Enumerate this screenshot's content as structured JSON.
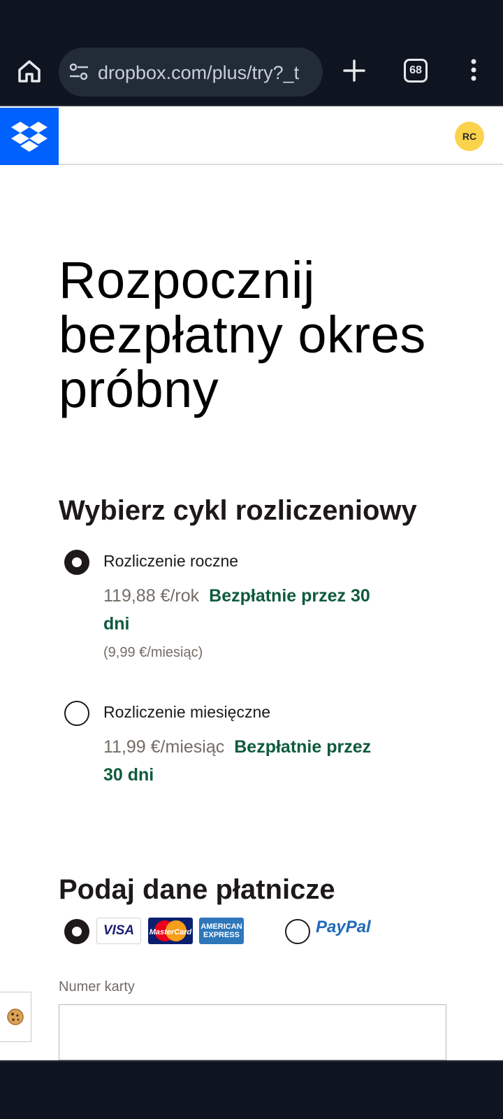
{
  "browser": {
    "url": "dropbox.com/plus/try?_t",
    "tab_count": "68"
  },
  "header": {
    "avatar_initials": "RC",
    "colors": {
      "brand": "#0061fe",
      "avatar": "#fad24b"
    }
  },
  "page": {
    "title": "Rozpocznij bezpłatny okres próbny",
    "billing": {
      "title": "Wybierz cykl rozliczeniowy",
      "options": [
        {
          "label": "Rozliczenie roczne",
          "price": "119,88 €/rok",
          "trial": "Bezpłatnie przez 30 dni",
          "sub_price": "(9,99 €/miesiąc)",
          "selected": true
        },
        {
          "label": "Rozliczenie miesięczne",
          "price": "11,99 €/miesiąc",
          "trial": "Bezpłatnie przez 30 dni",
          "selected": false
        }
      ]
    },
    "payment": {
      "title": "Podaj dane płatnicze",
      "card_brands": [
        "VISA",
        "MasterCard",
        "AMERICAN EXPRESS"
      ],
      "card_selected": true,
      "paypal_label": "PayPal",
      "paypal_selected": false,
      "card_number_label": "Numer karty",
      "card_number_value": ""
    },
    "cookie_icon": "cookie-icon"
  }
}
